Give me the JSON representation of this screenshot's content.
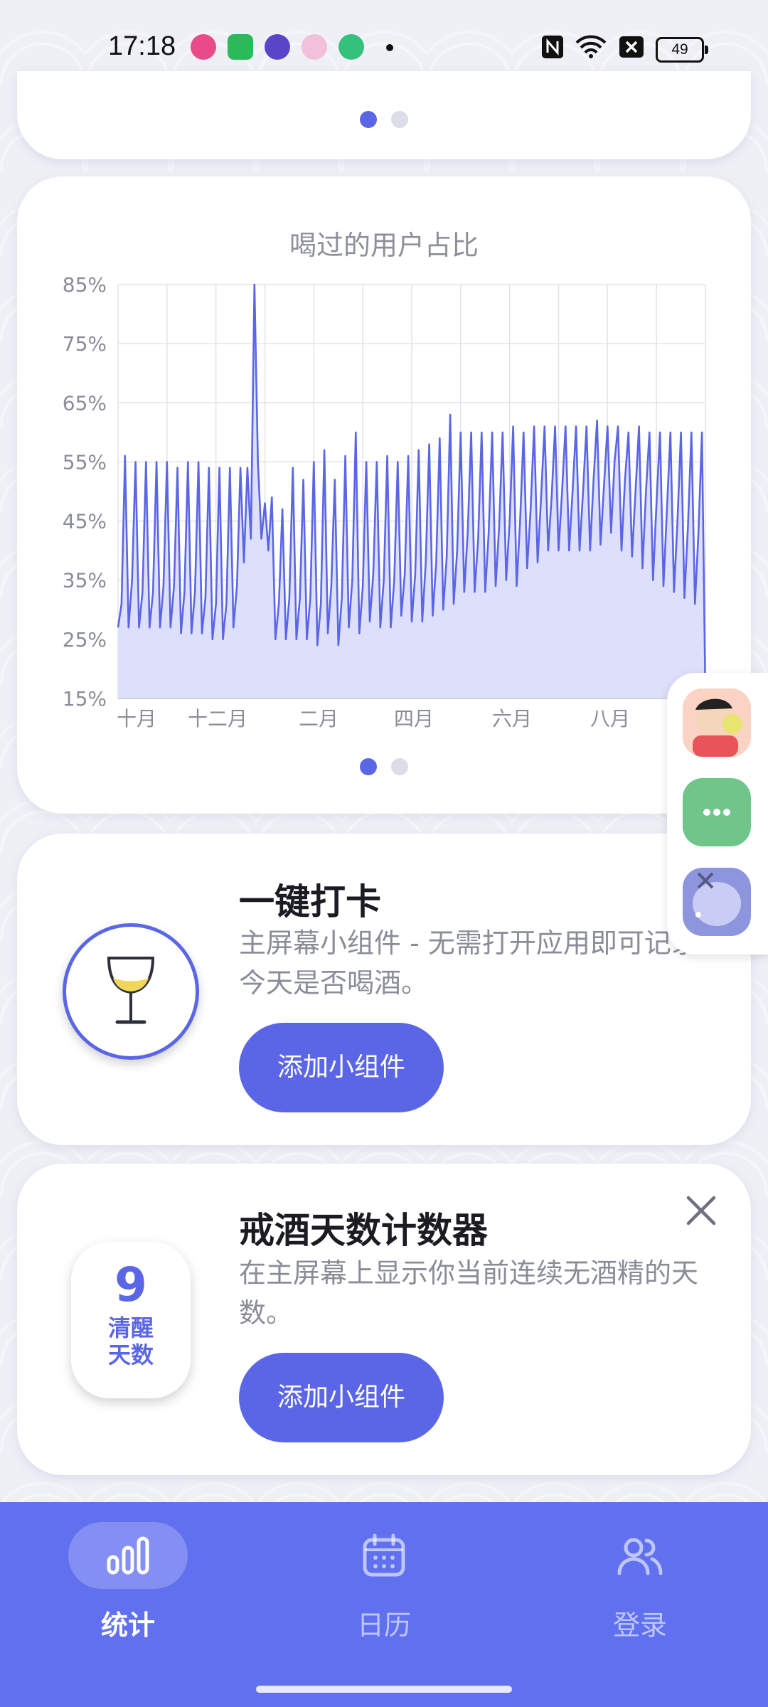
{
  "status_bar": {
    "time": "17:18",
    "battery": "49",
    "app_icon_colors": [
      "#e94b8a",
      "#2bb95a",
      "#5a45c8",
      "#f3c0d9",
      "#34c17b"
    ]
  },
  "colors": {
    "accent": "#5b66e6",
    "tab_bar": "#6070ef",
    "chart_fill": "#dcdefb"
  },
  "chart_card": {
    "title": "喝过的用户占比",
    "page_index": 0,
    "page_count": 2
  },
  "chart_data": {
    "type": "area",
    "title": "喝过的用户占比",
    "y_ticks": [
      "85%",
      "75%",
      "65%",
      "55%",
      "45%",
      "35%",
      "25%",
      "15%"
    ],
    "x_ticks": [
      "十月",
      "十二月",
      "二月",
      "四月",
      "六月",
      "八月"
    ],
    "ylim": [
      15,
      85
    ],
    "grid": true,
    "series": [
      {
        "values": [
          27,
          31,
          56,
          27,
          35,
          55,
          27,
          33,
          55,
          27,
          33,
          55,
          27,
          34,
          55,
          27,
          34,
          54,
          26,
          33,
          55,
          26,
          33,
          55,
          26,
          32,
          54,
          25,
          31,
          54,
          25,
          31,
          54,
          27,
          34,
          54,
          38,
          54,
          42,
          85,
          55,
          42,
          48,
          40,
          49,
          25,
          31,
          47,
          25,
          32,
          54,
          25,
          32,
          52,
          25,
          32,
          55,
          24,
          31,
          57,
          26,
          34,
          52,
          24,
          32,
          56,
          27,
          35,
          60,
          26,
          34,
          55,
          28,
          36,
          55,
          27,
          35,
          56,
          27,
          35,
          55,
          29,
          36,
          56,
          28,
          36,
          57,
          28,
          38,
          58,
          29,
          38,
          59,
          30,
          39,
          63,
          31,
          40,
          60,
          33,
          43,
          60,
          33,
          42,
          60,
          33,
          43,
          60,
          34,
          44,
          60,
          35,
          45,
          61,
          34,
          45,
          60,
          37,
          47,
          61,
          38,
          49,
          61,
          40,
          49,
          61,
          40,
          50,
          61,
          40,
          50,
          61,
          40,
          50,
          61,
          40,
          52,
          62,
          41,
          51,
          61,
          43,
          55,
          61,
          40,
          52,
          60,
          39,
          50,
          61,
          37,
          50,
          60,
          35,
          48,
          60,
          34,
          47,
          60,
          33,
          45,
          60,
          32,
          44,
          60,
          31,
          43,
          60,
          15
        ]
      }
    ]
  },
  "top_card": {
    "page_index": 0,
    "page_count": 2
  },
  "checkin_card": {
    "title": "一键打卡",
    "description": "主屏幕小组件 - 无需打开应用即可记录今天是否喝酒。",
    "button_label": "添加小组件"
  },
  "counter_card": {
    "title": "戒酒天数计数器",
    "description": "在主屏幕上显示你当前连续无酒精的天数。",
    "counter_value": "9",
    "counter_label": "清醒天数",
    "button_label": "添加小组件"
  },
  "tabs": [
    {
      "label": "统计",
      "icon": "bar-chart-icon",
      "active": true
    },
    {
      "label": "日历",
      "icon": "calendar-icon",
      "active": false
    },
    {
      "label": "登录",
      "icon": "users-icon",
      "active": false
    }
  ]
}
